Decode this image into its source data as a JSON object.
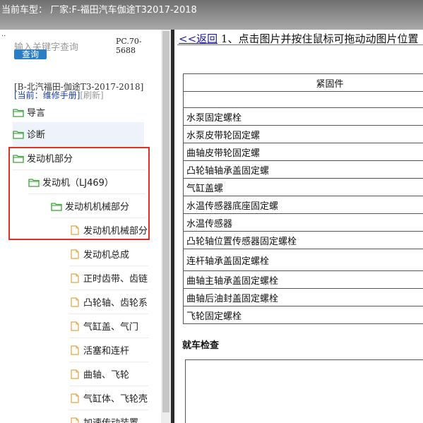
{
  "title_bar": {
    "text": "当前车型： 厂家:F-福田汽车伽途T32017-2018"
  },
  "left_panel": {
    "search_placeholder": "输入关键字查询",
    "search_button": "查询",
    "pc_code": "PC.70-5688",
    "vehicle": "[B-北汽福田-伽途T3-2017-2018]",
    "current_prefix": "[当前：",
    "current_value": "维修手册]",
    "refresh": "[刷新]",
    "tree": [
      {
        "label": "导言",
        "type": "folder"
      },
      {
        "label": "诊断",
        "type": "folder"
      },
      {
        "label": "发动机部分",
        "type": "folder"
      },
      {
        "label": "发动机（LJ469）",
        "type": "folder"
      },
      {
        "label": "发动机机械部分",
        "type": "folder"
      },
      {
        "label": "发动机机械部分",
        "type": "page"
      },
      {
        "label": "发动机总成",
        "type": "page"
      },
      {
        "label": "正时齿带、齿链",
        "type": "page"
      },
      {
        "label": "凸轮轴、齿轮系",
        "type": "page"
      },
      {
        "label": "气缸盖、气门",
        "type": "page"
      },
      {
        "label": "活塞和连杆",
        "type": "page"
      },
      {
        "label": "曲轴、飞轮",
        "type": "page"
      },
      {
        "label": "气缸体、飞轮壳",
        "type": "page"
      },
      {
        "label": "加速传动装置",
        "type": "page"
      }
    ]
  },
  "content": {
    "back_link": "<<返回",
    "instruction": " 1、点击图片并按住鼠标可拖动动图片位置",
    "table_header": "紧固件",
    "rows": [
      "水泵固定螺栓",
      "水泵皮带轮固定螺",
      "曲轴皮带轮固定螺",
      "凸轮轴轴承盖固定螺",
      "气缸盖螺",
      "水温传感器底座固定螺",
      "水温传感器",
      "凸轮轴位置传感器固定螺栓",
      "连杆轴承盖固定螺栓",
      "曲轴主轴承盖固定螺栓",
      "曲轴后油封盖固定螺栓",
      "飞轮固定螺栓"
    ],
    "section_title": "就车检查"
  },
  "colors": {
    "highlight_box": "#e0302d",
    "link": "#1a1aa6",
    "folder_icon": "#3aa335",
    "page_icon": "#e8a33d"
  }
}
